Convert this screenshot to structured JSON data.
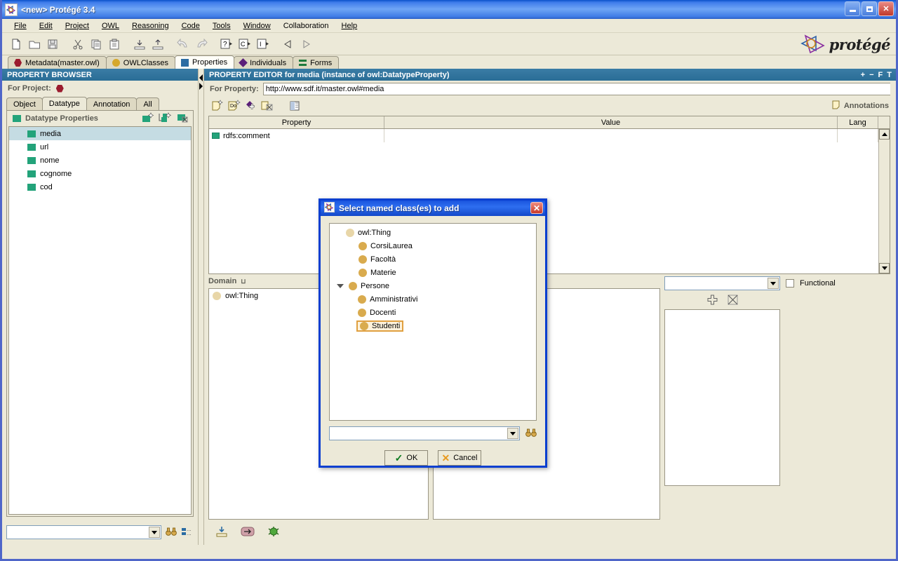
{
  "window": {
    "title": "<new>  Protégé 3.4",
    "icon": "protege-icon",
    "buttons": {
      "minimize": "_",
      "maximize": "□",
      "close": "✕"
    }
  },
  "menubar": {
    "items": [
      {
        "label": "File",
        "mnemonic": "F"
      },
      {
        "label": "Edit",
        "mnemonic": "E"
      },
      {
        "label": "Project",
        "mnemonic": "P"
      },
      {
        "label": "OWL",
        "mnemonic": "O"
      },
      {
        "label": "Reasoning",
        "mnemonic": "R"
      },
      {
        "label": "Code",
        "mnemonic": "C"
      },
      {
        "label": "Tools",
        "mnemonic": "T"
      },
      {
        "label": "Window",
        "mnemonic": "W"
      },
      {
        "label": "Collaboration",
        "mnemonic": ""
      },
      {
        "label": "Help",
        "mnemonic": "H"
      }
    ]
  },
  "toolbar": {
    "icons": [
      "new-project-icon",
      "open-project-icon",
      "save-project-icon",
      "cut-icon",
      "copy-icon",
      "paste-icon",
      "import-icon",
      "export-icon",
      "undo-icon",
      "redo-icon",
      "query-icon",
      "class-icon",
      "instance-icon",
      "back-icon",
      "forward-icon"
    ],
    "logo_text": "protégé"
  },
  "main_tabs": [
    {
      "label": "Metadata(master.owl)",
      "icon": "hex-red-icon",
      "active": false
    },
    {
      "label": "OWLClasses",
      "icon": "circle-gold-icon",
      "active": false
    },
    {
      "label": "Properties",
      "icon": "square-blue-icon",
      "active": true
    },
    {
      "label": "Individuals",
      "icon": "diamond-purple-icon",
      "active": false
    },
    {
      "label": "Forms",
      "icon": "forms-green-icon",
      "active": false
    }
  ],
  "property_browser": {
    "header": "PROPERTY BROWSER",
    "for_project_label": "For Project:",
    "project_icon": "hex-red-icon",
    "subtabs": [
      {
        "label": "Object",
        "active": false
      },
      {
        "label": "Datatype",
        "active": true
      },
      {
        "label": "Annotation",
        "active": false
      },
      {
        "label": "All",
        "active": false
      }
    ],
    "list_title": "Datatype Properties",
    "list_tools": [
      "create-datatype-property-icon",
      "create-subproperty-icon",
      "delete-property-icon"
    ],
    "properties": [
      {
        "name": "media",
        "selected": true
      },
      {
        "name": "url",
        "selected": false
      },
      {
        "name": "nome",
        "selected": false
      },
      {
        "name": "cognome",
        "selected": false
      },
      {
        "name": "cod",
        "selected": false
      }
    ],
    "search": {
      "value": "",
      "placeholder": ""
    },
    "search_tools": [
      "find-icon",
      "view-options-icon"
    ]
  },
  "property_editor": {
    "header": "PROPERTY EDITOR for media   (instance of owl:DatatypeProperty)",
    "header_controls": [
      "+",
      "−",
      "F",
      "T"
    ],
    "for_property_label": "For Property:",
    "property_uri": "http://www.sdf.it/master.owl#media",
    "toolbar_icons": [
      "create-annotation-icon",
      "create-documentation-icon",
      "add-property-value-icon",
      "remove-annotation-icon",
      "view-icon"
    ],
    "annotations_label": "Annotations",
    "annotations_icon": "note-icon",
    "table": {
      "columns": [
        "Property",
        "Value",
        "Lang"
      ],
      "rows": [
        {
          "property": "rdfs:comment",
          "property_icon": "datatype-property-icon",
          "value": "",
          "lang": ""
        }
      ]
    },
    "domain": {
      "title": "Domain",
      "title_badge": "⊔",
      "items": [
        {
          "label": "owl:Thing",
          "icon": "circle-gold-pale-icon"
        }
      ]
    },
    "range_combo": {
      "value": "",
      "placeholder": ""
    },
    "functional_checkbox": {
      "label": "Functional",
      "checked": false
    },
    "add_remove_icons": [
      "add-icon",
      "remove-icon"
    ],
    "bottom_icons": [
      "import-values-icon",
      "move-icon",
      "debug-icon"
    ]
  },
  "dialog": {
    "title": "Select named class(es) to add",
    "icon": "protege-icon",
    "close_label": "✕",
    "tree": [
      {
        "label": "owl:Thing",
        "depth": 0,
        "icon": "circle-gold-pale-icon",
        "expanded": null,
        "selected": false
      },
      {
        "label": "CorsiLaurea",
        "depth": 1,
        "icon": "circle-gold-icon",
        "expanded": null,
        "selected": false
      },
      {
        "label": "Facoltà",
        "depth": 1,
        "icon": "circle-gold-icon",
        "expanded": null,
        "selected": false
      },
      {
        "label": "Materie",
        "depth": 1,
        "icon": "circle-gold-icon",
        "expanded": null,
        "selected": false
      },
      {
        "label": "Persone",
        "depth": 1,
        "icon": "circle-gold-icon",
        "expanded": true,
        "selected": false
      },
      {
        "label": "Amministrativi",
        "depth": 2,
        "icon": "circle-gold-icon",
        "expanded": null,
        "selected": false
      },
      {
        "label": "Docenti",
        "depth": 2,
        "icon": "circle-gold-icon",
        "expanded": null,
        "selected": false
      },
      {
        "label": "Studenti",
        "depth": 2,
        "icon": "circle-gold-icon",
        "expanded": null,
        "selected": true
      }
    ],
    "search_combo": {
      "value": "",
      "placeholder": ""
    },
    "search_icon": "binoculars-icon",
    "ok_label": "OK",
    "cancel_label": "Cancel"
  },
  "colors": {
    "titlebar_blue": "#3d7bea",
    "panel_header_blue": "#2a6d96",
    "dialog_blue": "#1a55de",
    "face": "#ece9d8",
    "selection": "#c5dce3",
    "gold": "#d9ab4e",
    "green": "#23a37a",
    "selected_outline": "#e0a040"
  }
}
